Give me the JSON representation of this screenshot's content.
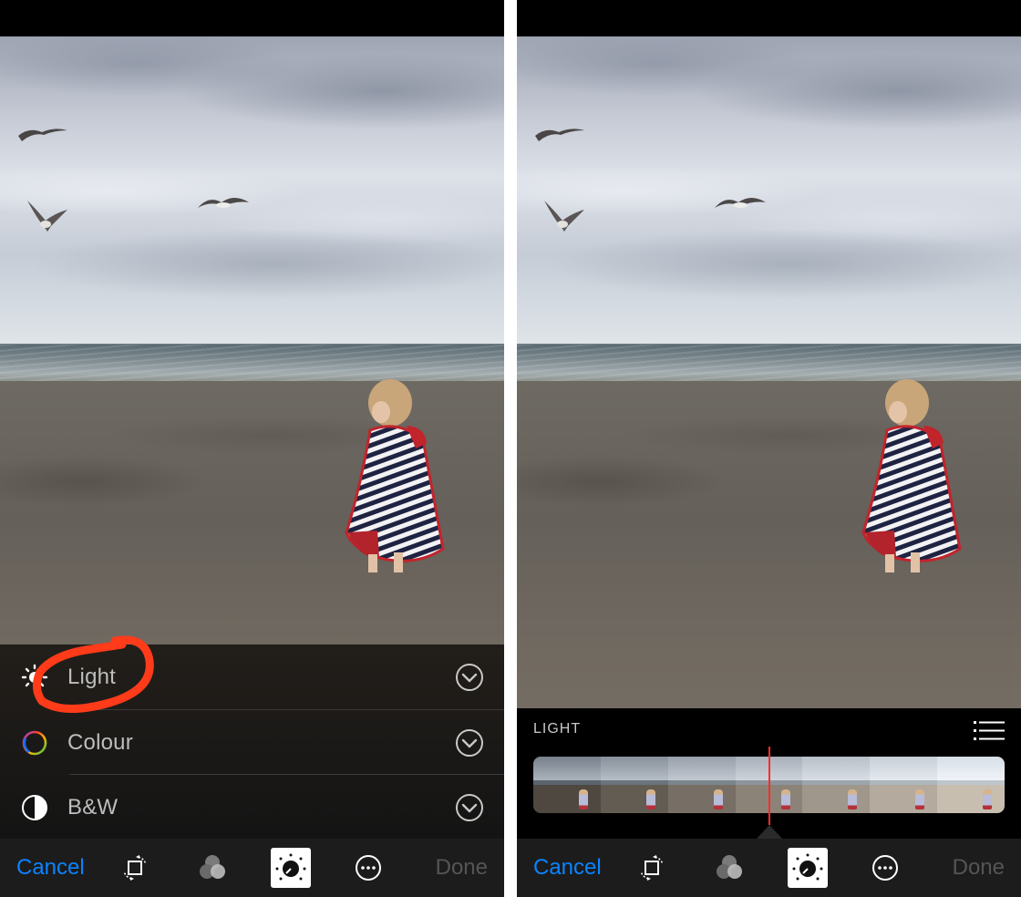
{
  "colors": {
    "accent_blue": "#0a84ff",
    "done_disabled": "#555555",
    "annotation_red": "#ff3b1a",
    "scrubber_red": "#ff2d2d",
    "panel_text": "#bdbdbd",
    "toolbar_bg": "#1c1c1c"
  },
  "left_screen": {
    "photo": {
      "description": "Toddler in striped hooded towel on a beach with seagulls overhead"
    },
    "adjustments": [
      {
        "label": "Light",
        "icon": "sun-icon",
        "highlighted": true
      },
      {
        "label": "Colour",
        "icon": "color-wheel-icon",
        "highlighted": false
      },
      {
        "label": "B&W",
        "icon": "half-circle-icon",
        "highlighted": false
      }
    ],
    "toolbar": {
      "cancel_label": "Cancel",
      "done_label": "Done",
      "tools": [
        "crop-rotate-icon",
        "filters-icon",
        "adjust-dial-icon",
        "more-icon"
      ],
      "active_tool": "adjust-dial-icon"
    }
  },
  "right_screen": {
    "photo": {
      "description": "Same beach photo of toddler and seagulls"
    },
    "light_panel": {
      "title": "LIGHT",
      "filmstrip_frames": 7,
      "scrubber_position_fraction": 0.5
    },
    "toolbar": {
      "cancel_label": "Cancel",
      "done_label": "Done",
      "tools": [
        "crop-rotate-icon",
        "filters-icon",
        "adjust-dial-icon",
        "more-icon"
      ],
      "active_tool": "adjust-dial-icon"
    }
  }
}
